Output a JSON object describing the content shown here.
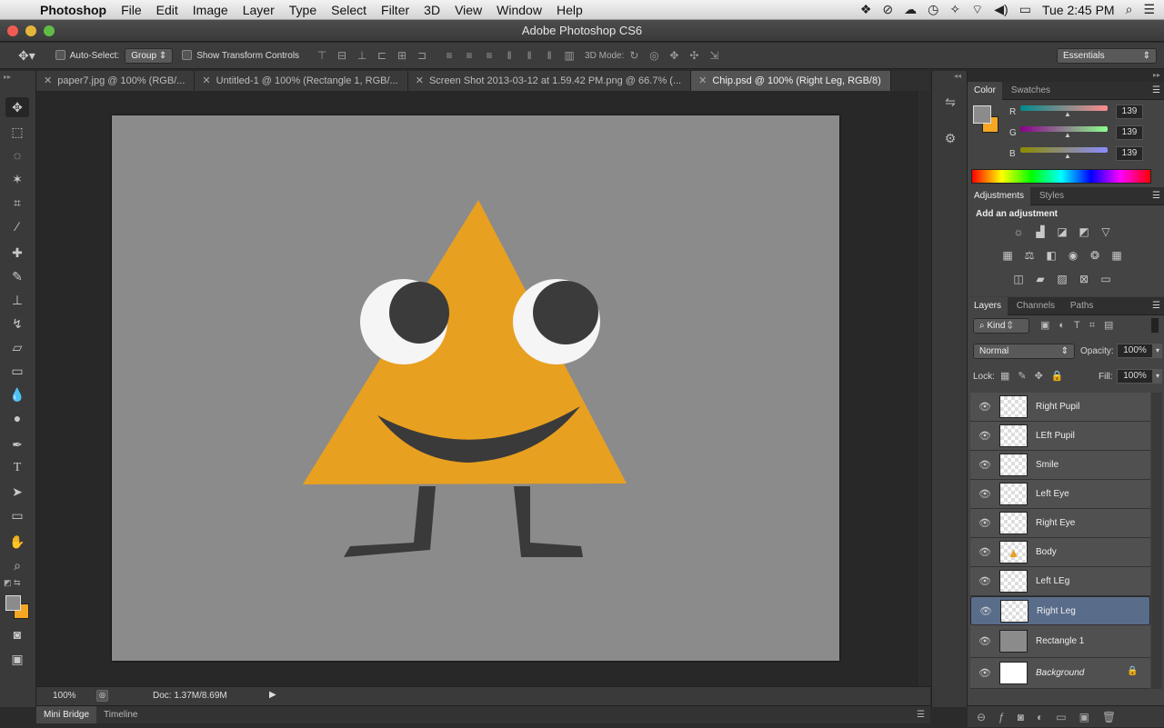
{
  "menubar": {
    "app": "Photoshop",
    "items": [
      "File",
      "Edit",
      "Image",
      "Layer",
      "Type",
      "Select",
      "Filter",
      "3D",
      "View",
      "Window",
      "Help"
    ],
    "clock": "Tue 2:45 PM"
  },
  "window": {
    "title": "Adobe Photoshop CS6"
  },
  "options": {
    "auto_select_label": "Auto-Select:",
    "auto_select_value": "Group",
    "show_transform_label": "Show Transform Controls",
    "mode_3d_label": "3D Mode:",
    "workspace": "Essentials"
  },
  "tabs": [
    {
      "label": "paper7.jpg @ 100% (RGB/..."
    },
    {
      "label": "Untitled-1 @ 100% (Rectangle 1, RGB/..."
    },
    {
      "label": "Screen Shot 2013-03-12 at 1.59.42 PM.png @ 66.7% (..."
    },
    {
      "label": "Chip.psd @ 100% (Right Leg, RGB/8)"
    }
  ],
  "status": {
    "zoom": "100%",
    "doc": "Doc: 1.37M/8.69M"
  },
  "bottom_tabs": [
    "Mini Bridge",
    "Timeline"
  ],
  "color_panel": {
    "tabs": [
      "Color",
      "Swatches"
    ],
    "channels": [
      {
        "label": "R",
        "value": "139"
      },
      {
        "label": "G",
        "value": "139"
      },
      {
        "label": "B",
        "value": "139"
      }
    ],
    "foreground": "#8b8b8b",
    "background": "#f5a623"
  },
  "adjust_panel": {
    "tabs": [
      "Adjustments",
      "Styles"
    ],
    "heading": "Add an adjustment"
  },
  "layers_panel": {
    "tabs": [
      "Layers",
      "Channels",
      "Paths"
    ],
    "filter": "Kind",
    "blend_mode": "Normal",
    "opacity_label": "Opacity:",
    "opacity": "100%",
    "lock_label": "Lock:",
    "fill_label": "Fill:",
    "fill": "100%",
    "layers": [
      "Right Pupil",
      "LEft Pupil",
      "Smile",
      "Left Eye",
      "Right Eye",
      "Body",
      "Left LEg",
      "Right Leg",
      "Rectangle 1",
      "Background"
    ],
    "selected": "Right Leg"
  },
  "icons": [
    "apple-icon",
    "move-tool-icon",
    "eye-icon",
    "lock-icon",
    "search-icon",
    "wifi-icon"
  ]
}
